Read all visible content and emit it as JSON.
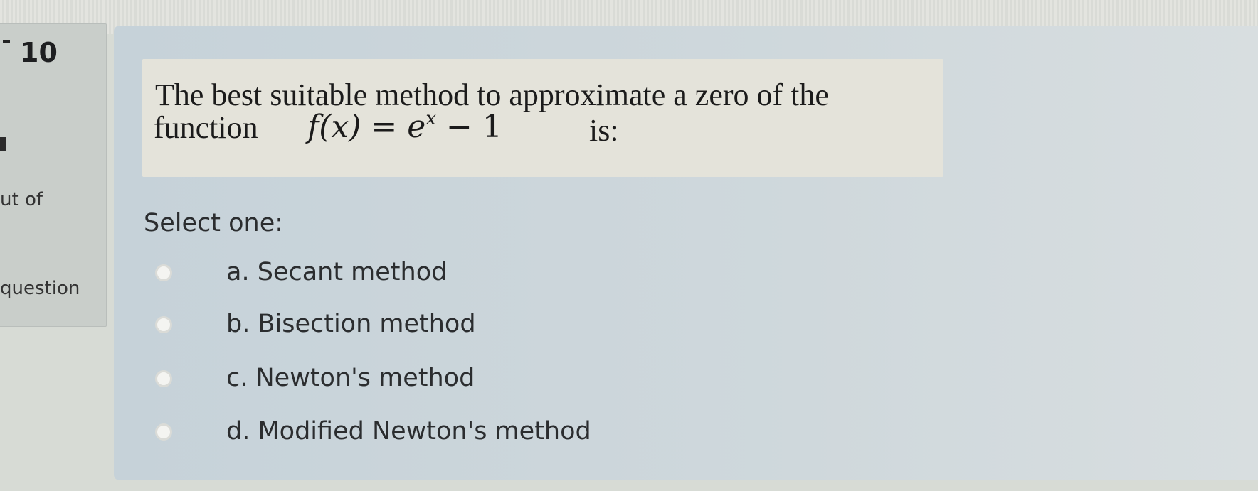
{
  "info": {
    "question_number": "10",
    "out_of_text": "ut of",
    "question_link_text": "question"
  },
  "question": {
    "line1": "The best suitable method to approximate a zero of the",
    "line2_word": "function",
    "formula_lhs": "f(x) = e",
    "formula_exp": "x",
    "formula_rhs": " − 1",
    "line2_tail": "is:"
  },
  "prompt": "Select one:",
  "options": [
    {
      "label": "a. Secant method",
      "selected": false
    },
    {
      "label": "b. Bisection method",
      "selected": false
    },
    {
      "label": "c. Newton's method",
      "selected": false
    },
    {
      "label": "d. Modified Newton's method",
      "selected": false
    }
  ],
  "colors": {
    "question_box": "#e4e3da",
    "content_panel": "#cfd8dc",
    "info_panel": "#c9ceca"
  }
}
